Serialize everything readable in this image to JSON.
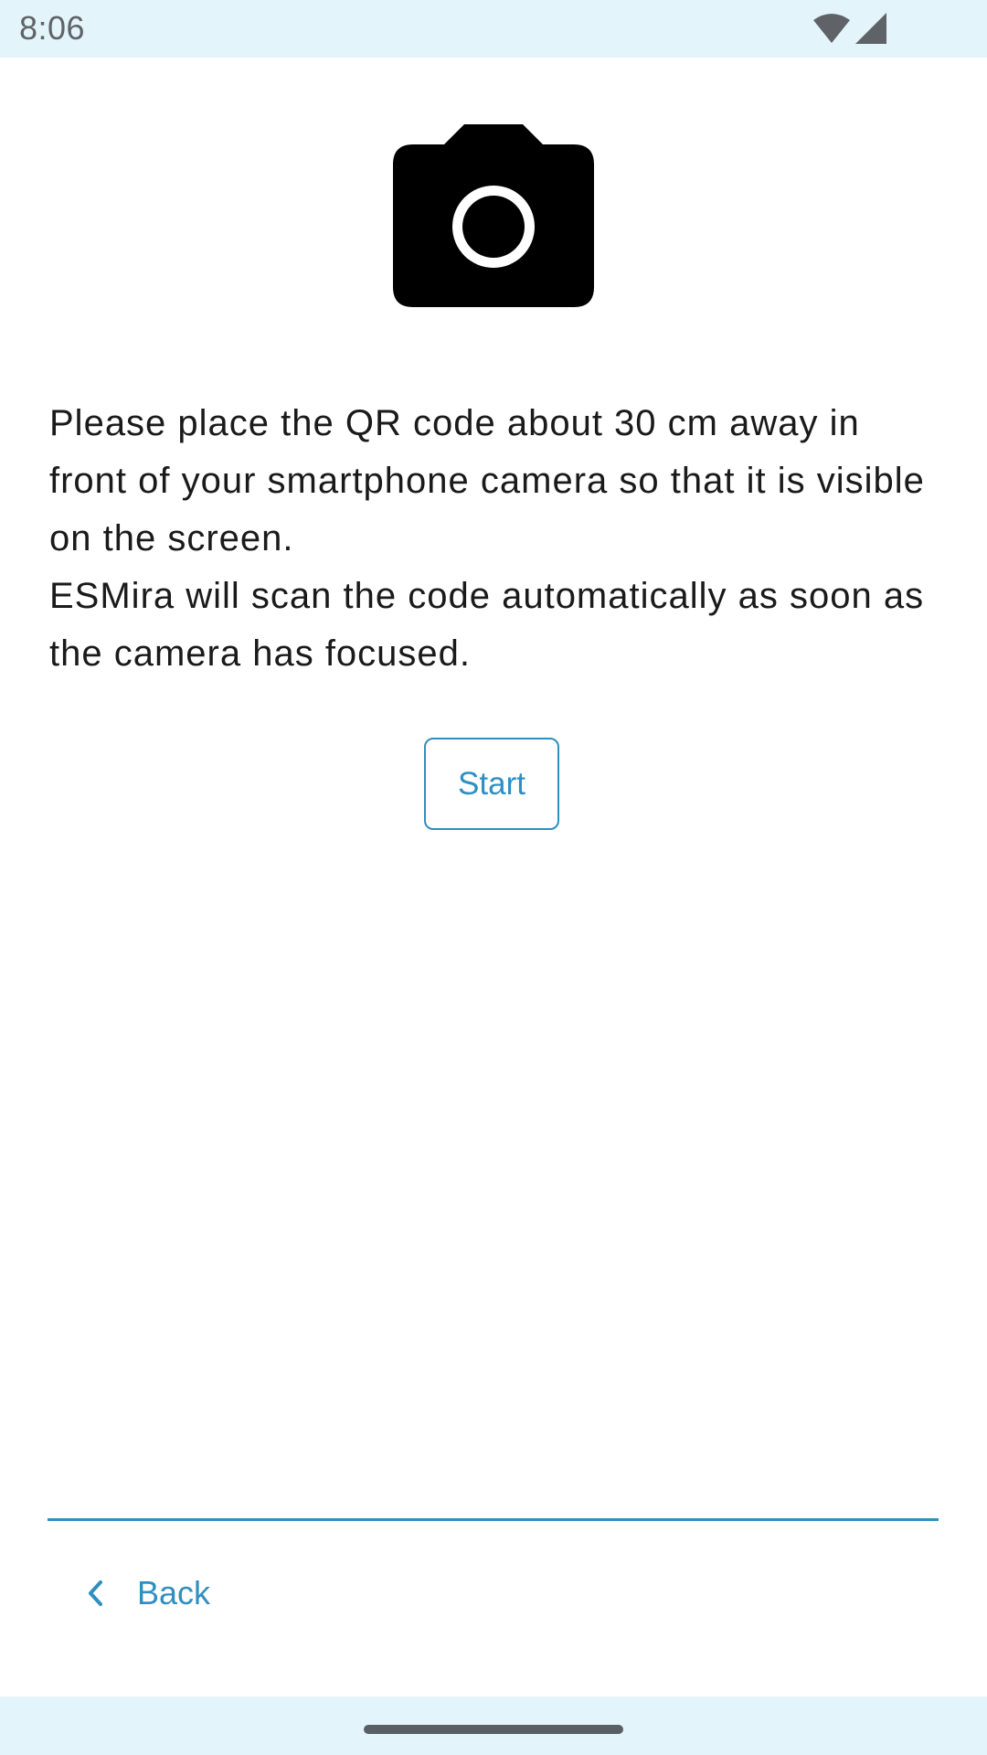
{
  "status_bar": {
    "time": "8:06",
    "icons": [
      "wifi-icon",
      "cellular-signal-icon"
    ],
    "background": "#e3f5fb"
  },
  "main": {
    "camera_icon": "camera-icon",
    "instruction_paragraphs": [
      "Please place the QR code about 30 cm away in front of your smartphone camera so that it is visible on the screen.",
      "ESMira will scan the code automatically as soon as the camera has focused."
    ],
    "start_label": "Start"
  },
  "footer": {
    "back_label": "Back",
    "back_icon": "chevron-left-icon"
  },
  "colors": {
    "accent": "#2f8fc1",
    "text": "#1a1a1a",
    "system_bars": "#e3f5fb"
  }
}
